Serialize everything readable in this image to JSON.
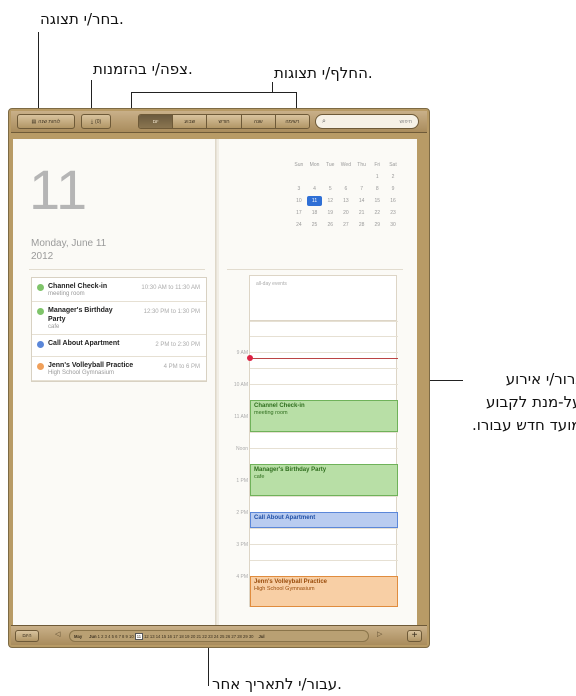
{
  "callouts": {
    "choose_view": "בחר/י תצוגה.",
    "view_invitations": "צפה/י בהזמנות.",
    "switch_views": "החלף/י תצוגות.",
    "drag_event_line1": "גרור/י אירוע",
    "drag_event_line2": "על-מנת לקבוע",
    "drag_event_line3": "מועד חדש עבורו.",
    "goto_date": "עבור/י לתאריך אחר."
  },
  "toolbar": {
    "calendars_button": "לוחות שנה",
    "invitations_button": "(0)",
    "segments": [
      {
        "label": "יום",
        "active": true
      },
      {
        "label": "שבוע",
        "active": false
      },
      {
        "label": "חודש",
        "active": false
      },
      {
        "label": "שנה",
        "active": false
      },
      {
        "label": "רשימה",
        "active": false
      }
    ],
    "search_placeholder": "חיפוש"
  },
  "left_page": {
    "day_number": "11",
    "date_text": "Monday, June 11",
    "year_text": "2012",
    "events": [
      {
        "title": "Channel Check-in",
        "sub": "meeting room",
        "time": "10:30 AM to 11:30 AM",
        "color": "#7fc46a"
      },
      {
        "title": "Manager's Birthday Party",
        "sub": "cafe",
        "time": "12:30 PM to 1:30 PM",
        "color": "#7fc46a"
      },
      {
        "title": "Call About Apartment",
        "sub": "",
        "time": "2 PM to 2:30 PM",
        "color": "#5b87d9"
      },
      {
        "title": "Jenn's Volleyball Practice",
        "sub": "High School Gymnasium",
        "time": "4 PM to 6 PM",
        "color": "#f0a05a"
      }
    ]
  },
  "mini_calendar": {
    "weekdays": [
      "Sun",
      "Mon",
      "Tue",
      "Wed",
      "Thu",
      "Fri",
      "Sat"
    ],
    "weeks": [
      [
        "",
        "",
        "",
        "",
        "",
        "1",
        "2"
      ],
      [
        "3",
        "4",
        "5",
        "6",
        "7",
        "8",
        "9"
      ],
      [
        "10",
        "11",
        "12",
        "13",
        "14",
        "15",
        "16"
      ],
      [
        "17",
        "18",
        "19",
        "20",
        "21",
        "22",
        "23"
      ],
      [
        "24",
        "25",
        "26",
        "27",
        "28",
        "29",
        "30"
      ]
    ],
    "selected": "11"
  },
  "day_view": {
    "all_day_label": "all-day events",
    "hours": [
      "9 AM",
      "10 AM",
      "11 AM",
      "Noon",
      "1 PM",
      "2 PM",
      "3 PM",
      "4 PM"
    ],
    "events": [
      {
        "title": "Channel Check-in",
        "sub": "meeting room",
        "bg": "#b8dfa6",
        "border": "#6fb25a",
        "text": "#2f6e1e"
      },
      {
        "title": "Manager's Birthday Party",
        "sub": "cafe",
        "bg": "#b8dfa6",
        "border": "#6fb25a",
        "text": "#2f6e1e"
      },
      {
        "title": "Call About Apartment",
        "sub": "",
        "bg": "#b9ccf0",
        "border": "#5b87d9",
        "text": "#1f4fa6"
      },
      {
        "title": "Jenn's Volleyball Practice",
        "sub": "High School Gymnasium",
        "bg": "#f8cfa5",
        "border": "#e08c3e",
        "text": "#9a4d0c"
      }
    ]
  },
  "bottom_bar": {
    "today_button": "היום",
    "prev_arrow": "◁",
    "next_arrow": "▷",
    "strip_start": "May",
    "strip_month": "Jun",
    "strip_days_before": "1 2 3 4 5 6 7 8 9 10",
    "strip_current": "11",
    "strip_days_after": "12 13 14 15 16 17 18 19 20 21 22 23 24 25 26 27 28 29 30",
    "strip_end": "Jul",
    "add_button": "+"
  }
}
